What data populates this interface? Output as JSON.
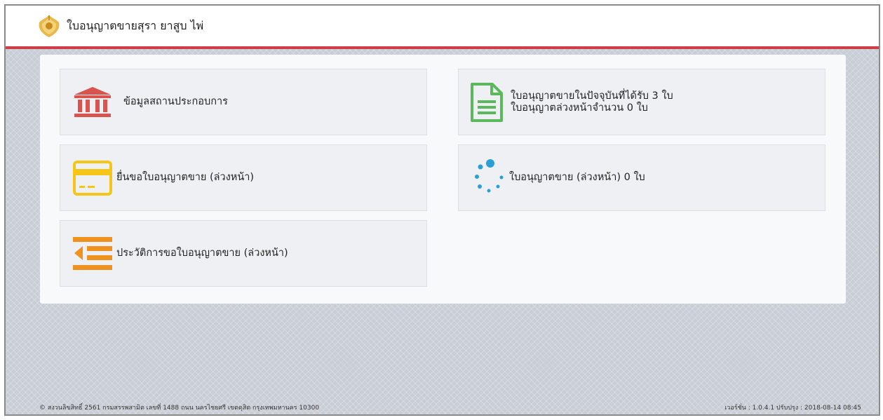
{
  "header": {
    "title": "ใบอนุญาตขายสุรา ยาสูบ ไพ่",
    "logo_icon": "royal-emblem-icon"
  },
  "cards": [
    {
      "label": "ข้อมูลสถานประกอบการ",
      "icon": "institution-icon",
      "color": "#d9534f"
    },
    {
      "line1": "ใบอนุญาตขายในปัจจุบันที่ได้รับ 3 ใบ",
      "line2": "ใบอนุญาตล่วงหน้าจำนวน 0 ใบ",
      "icon": "document-icon",
      "color": "#5cb85c"
    },
    {
      "label": "ยื่นขอใบอนุญาตขาย (ล่วงหน้า)",
      "icon": "credit-card-icon",
      "color": "#f5c518"
    },
    {
      "label": "ใบอนุญาตขาย (ล่วงหน้า) 0 ใบ",
      "icon": "spinner-icon",
      "color": "#2a9fd6"
    },
    {
      "label": "ประวัติการขอใบอนุญาตขาย (ล่วงหน้า)",
      "icon": "outdent-icon",
      "color": "#f0921e"
    }
  ],
  "footer": {
    "copyright": "© สงวนลิขสิทธิ์ 2561 กรมสรรพสามิต เลขที่ 1488 ถนน นครไชยศรี เขตดุสิต กรุงเทพมหานคร 10300",
    "version": "เวอร์ชั่น : 1.0.4.1 ปรับปรุง : 2018-08-14 08:45"
  }
}
